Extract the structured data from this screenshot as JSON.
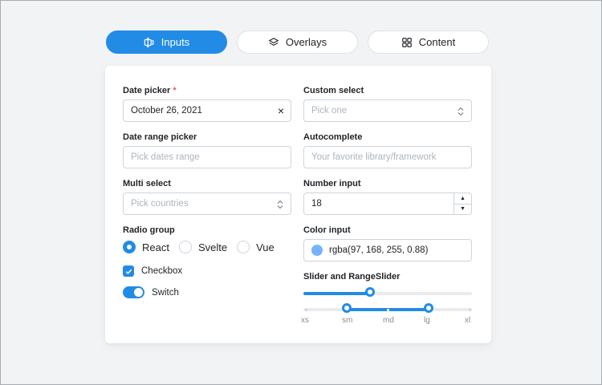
{
  "tabs": [
    {
      "label": "Inputs",
      "icon": "input-icon",
      "active": true
    },
    {
      "label": "Overlays",
      "icon": "layers-icon",
      "active": false
    },
    {
      "label": "Content",
      "icon": "grid-icon",
      "active": false
    }
  ],
  "left": {
    "date_picker": {
      "label": "Date picker",
      "required_mark": "*",
      "value": "October 26, 2021",
      "clear_icon": "×"
    },
    "date_range": {
      "label": "Date range picker",
      "placeholder": "Pick dates range"
    },
    "multi_select": {
      "label": "Multi select",
      "placeholder": "Pick countries"
    },
    "radio_group": {
      "label": "Radio group",
      "options": [
        "React",
        "Svelte",
        "Vue"
      ],
      "selected": "React"
    },
    "checkbox": {
      "label": "Checkbox",
      "checked": true
    },
    "switch": {
      "label": "Switch",
      "on": true
    }
  },
  "right": {
    "custom_select": {
      "label": "Custom select",
      "placeholder": "Pick one"
    },
    "autocomplete": {
      "label": "Autocomplete",
      "placeholder": "Your favorite library/framework"
    },
    "number_input": {
      "label": "Number input",
      "value": "18"
    },
    "color_input": {
      "label": "Color input",
      "value": "rgba(97, 168, 255, 0.88)",
      "swatch_color": "#61a8ff"
    },
    "slider": {
      "label": "Slider and RangeSlider",
      "slider_value": 0.4,
      "range_values": [
        1,
        3
      ],
      "marks": [
        "xs",
        "sm",
        "md",
        "lg",
        "xl"
      ]
    }
  },
  "colors": {
    "accent": "#228be6",
    "required": "#fa5252"
  }
}
